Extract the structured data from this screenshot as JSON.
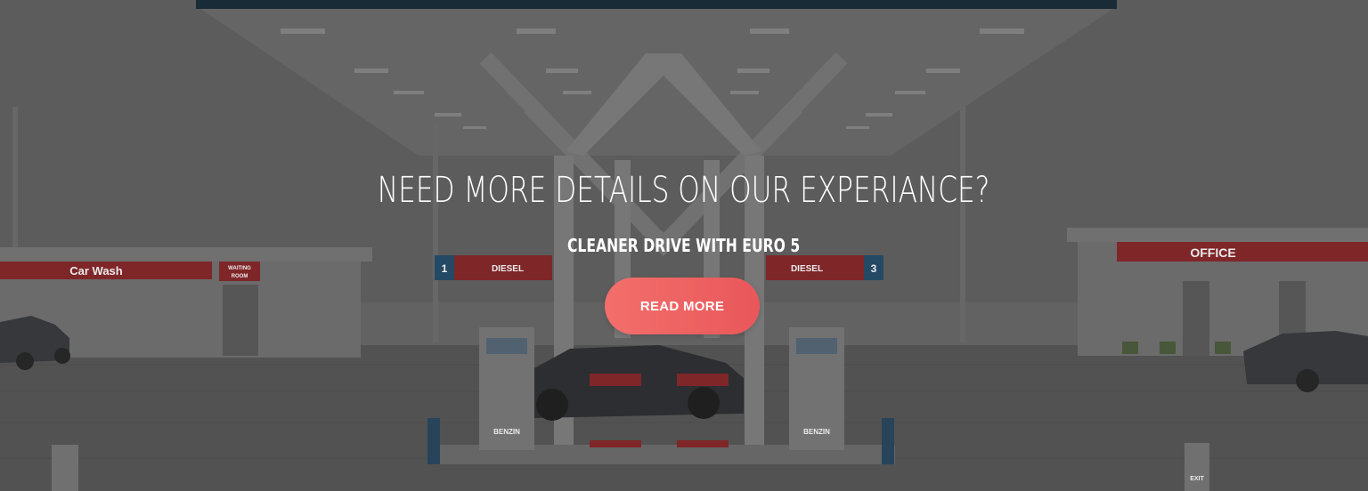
{
  "hero": {
    "title": "NEED MORE DETAILS ON OUR EXPERIANCE?",
    "subtitle": "CLEANER DRIVE WITH EURO 5",
    "button_label": "READ MORE",
    "accent_color": "#ef6566"
  },
  "scene": {
    "car_wash_sign": "Car Wash",
    "waiting_room_sign_line1": "WAITING",
    "waiting_room_sign_line2": "ROOM",
    "office_sign": "OFFICE",
    "pump_left_number": "1",
    "pump_left_label": "DIESEL",
    "pump_right_label": "DIESEL",
    "pump_right_number": "3",
    "pump_brand": "BENZIN",
    "exit_sign": "EXIT"
  }
}
